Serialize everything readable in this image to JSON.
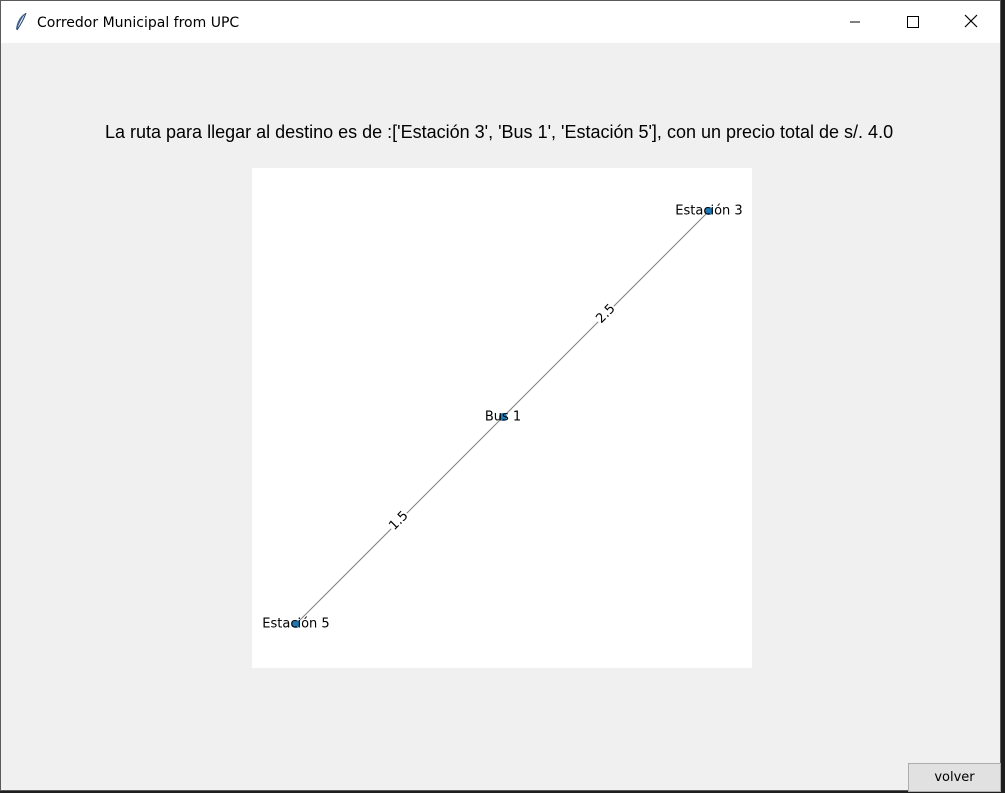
{
  "window": {
    "title": "Corredor Municipal from UPC",
    "icon": "feather-icon",
    "controls": [
      "minimize-icon",
      "maximize-icon",
      "close-icon"
    ]
  },
  "main": {
    "route_text": "La ruta para llegar al destino es de :['Estación 3', 'Bus 1', 'Estación 5'], con un precio total de s/. 4.0"
  },
  "graph": {
    "nodes": [
      {
        "id": "n1",
        "label": "Estación 3"
      },
      {
        "id": "n2",
        "label": "Bus 1"
      },
      {
        "id": "n3",
        "label": "Estación 5"
      }
    ],
    "edges": [
      {
        "from": "Estación 3",
        "to": "Bus 1",
        "weight": "2.5"
      },
      {
        "from": "Bus 1",
        "to": "Estación 5",
        "weight": "1.5"
      }
    ],
    "node_color": "#1f77b4",
    "edge_color": "#808080"
  },
  "footer": {
    "back_label": "volver"
  }
}
